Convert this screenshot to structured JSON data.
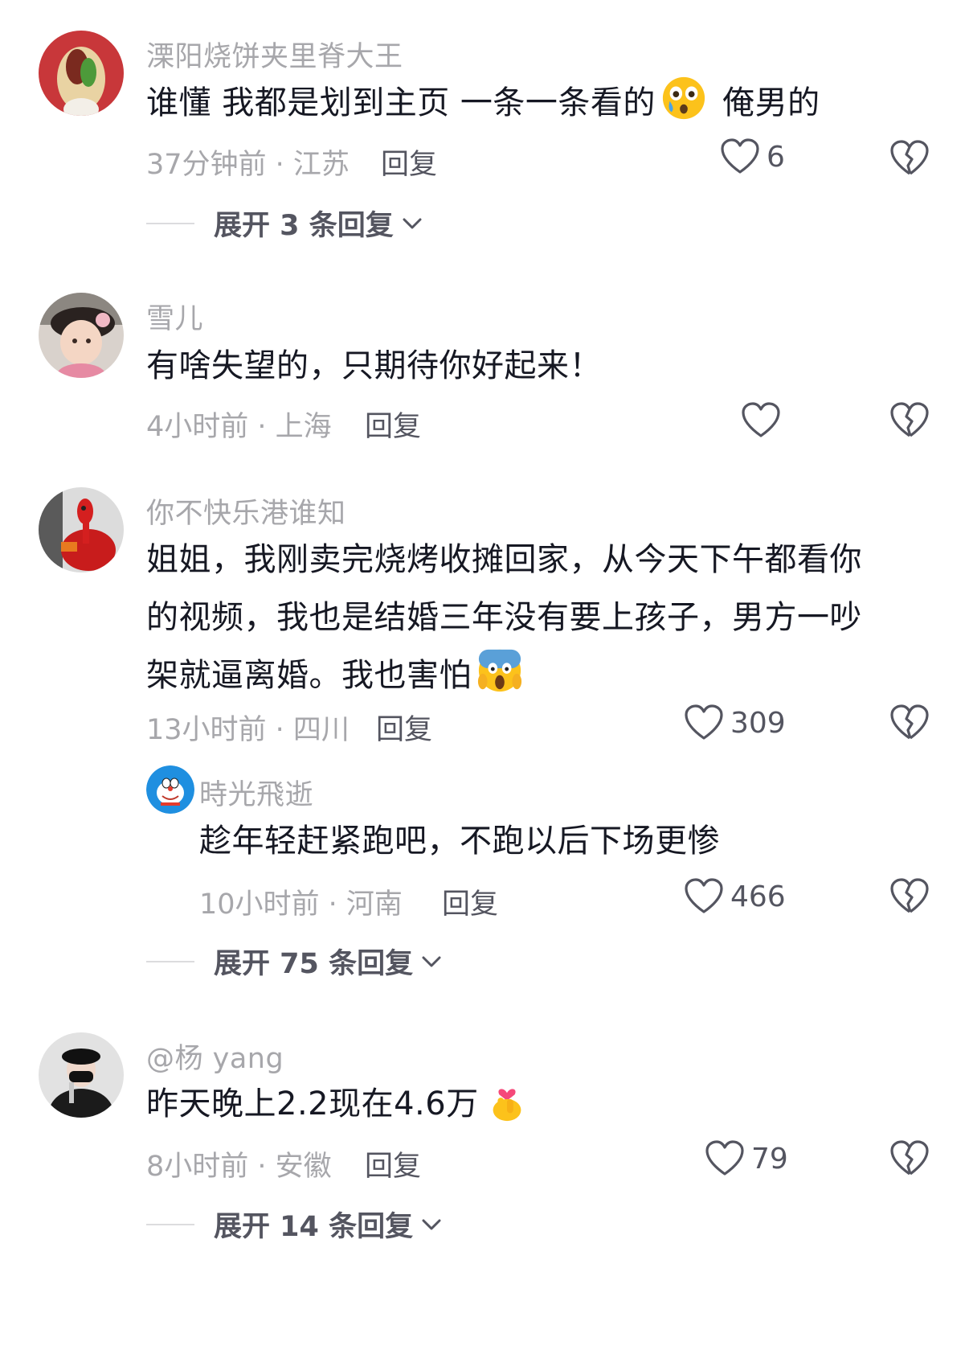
{
  "comments": [
    {
      "username": "溧阳烧饼夹里脊大王",
      "text_before": "谁懂 我都是划到主页 一条一条看的",
      "emoji": "crying-face-emoji",
      "text_after": " 俺男的",
      "time_location": "37分钟前 · 江苏",
      "reply_label": "回复",
      "likes": "6",
      "expand_label": "展开 3 条回复"
    },
    {
      "username": "雪儿",
      "text": "有啥失望的，只期待你好起来！",
      "time_location": "4小时前 · 上海",
      "reply_label": "回复",
      "likes": ""
    },
    {
      "username": "你不快乐港谁知",
      "text_line1": "姐姐，我刚卖完烧烤收摊回家，从今天下午都看你",
      "text_line2": "的视频，我也是结婚三年没有要上孩子，男方一吵",
      "text_line3_before": "架就逼离婚。我也害怕",
      "emoji": "screaming-face-emoji",
      "time_location": "13小时前 · 四川",
      "reply_label": "回复",
      "likes": "309",
      "sub_reply": {
        "username": "時光飛逝",
        "text": "趁年轻赶紧跑吧，不跑以后下场更惨",
        "time_location": "10小时前 · 河南",
        "reply_label": "回复",
        "likes": "466"
      },
      "expand_label": "展开 75 条回复"
    },
    {
      "username": "@杨 yang",
      "text_before": "昨天晚上2.2现在4.6万",
      "emoji": "finger-heart-emoji",
      "time_location": "8小时前 · 安徽",
      "reply_label": "回复",
      "likes": "79",
      "expand_label": "展开 14 条回复"
    }
  ],
  "colors": {
    "text_primary": "#161823",
    "text_secondary": "#a7a7ab",
    "text_action": "#545560"
  }
}
